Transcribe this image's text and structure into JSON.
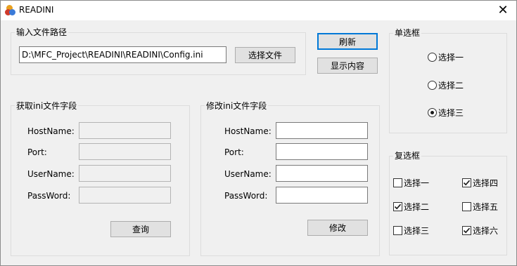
{
  "window": {
    "title": "READINI",
    "close_glyph": "✕"
  },
  "path_group": {
    "label": "输入文件路径",
    "path_value": "D:\\MFC_Project\\READINI\\READINI\\Config.ini",
    "select_button": "选择文件"
  },
  "actions": {
    "refresh": "刷新",
    "show_content": "显示内容"
  },
  "get_group": {
    "label": "获取ini文件字段",
    "fields": [
      {
        "label": "HostName:",
        "value": ""
      },
      {
        "label": "Port:",
        "value": ""
      },
      {
        "label": "UserName:",
        "value": ""
      },
      {
        "label": "PassWord:",
        "value": ""
      }
    ],
    "query_button": "查询"
  },
  "set_group": {
    "label": "修改ini文件字段",
    "fields": [
      {
        "label": "HostName:",
        "value": ""
      },
      {
        "label": "Port:",
        "value": ""
      },
      {
        "label": "UserName:",
        "value": ""
      },
      {
        "label": "PassWord:",
        "value": ""
      }
    ],
    "modify_button": "修改"
  },
  "radio_group": {
    "label": "单选框",
    "options": [
      {
        "label": "选择一",
        "selected": false
      },
      {
        "label": "选择二",
        "selected": false
      },
      {
        "label": "选择三",
        "selected": true
      }
    ]
  },
  "check_group": {
    "label": "复选框",
    "options": [
      {
        "label": "选择一",
        "checked": false
      },
      {
        "label": "选择四",
        "checked": true
      },
      {
        "label": "选择二",
        "checked": true
      },
      {
        "label": "选择五",
        "checked": false
      },
      {
        "label": "选择三",
        "checked": false
      },
      {
        "label": "选择六",
        "checked": true
      }
    ]
  },
  "colors": {
    "dialog_bg": "#f0f0f0",
    "default_button_border": "#0078d7",
    "button_bg": "#e1e1e1"
  },
  "icons": {
    "app": "app-icon",
    "close": "close-icon",
    "check": "check-icon"
  }
}
